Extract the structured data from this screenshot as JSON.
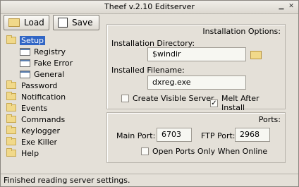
{
  "window": {
    "title": "Theef v.2.10 Editserver"
  },
  "toolbar": {
    "load": "Load",
    "save": "Save"
  },
  "tree": {
    "setup": "Setup",
    "children": [
      "Registry",
      "Fake Error",
      "General"
    ],
    "items": [
      "Password",
      "Notification",
      "Events",
      "Commands",
      "Keylogger",
      "Exe Killer",
      "Help"
    ]
  },
  "installation": {
    "title": "Installation Options:",
    "dir_label": "Installation Directory:",
    "dir_value": "$windir",
    "file_label": "Installed Filename:",
    "file_value": "dxreg.exe",
    "create_visible": "Create Visible Server",
    "melt_after": "Melt After Install"
  },
  "ports": {
    "title": "Ports:",
    "main_label": "Main Port:",
    "main_value": "6703",
    "ftp_label": "FTP Port:",
    "ftp_value": "2968",
    "open_only": "Open Ports Only When Online"
  },
  "status": "Finished reading server settings."
}
